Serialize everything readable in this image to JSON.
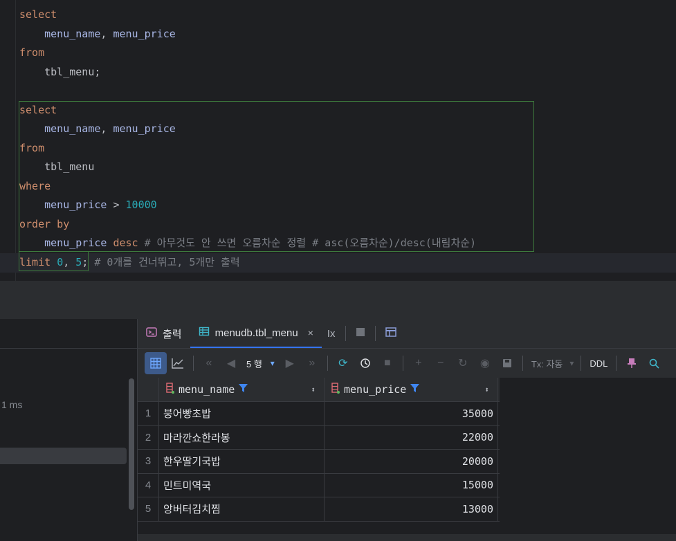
{
  "editor": {
    "lines": [
      [
        {
          "t": "select",
          "c": "kw"
        }
      ],
      [
        {
          "t": "    ",
          "c": "txt"
        },
        {
          "t": "menu_name",
          "c": "col"
        },
        {
          "t": ", ",
          "c": "txt"
        },
        {
          "t": "menu_price",
          "c": "col"
        }
      ],
      [
        {
          "t": "from",
          "c": "kw"
        }
      ],
      [
        {
          "t": "    tbl_menu;",
          "c": "txt"
        }
      ],
      [
        {
          "t": "",
          "c": "txt"
        }
      ],
      [
        {
          "t": "select",
          "c": "kw"
        }
      ],
      [
        {
          "t": "    ",
          "c": "txt"
        },
        {
          "t": "menu_name",
          "c": "col"
        },
        {
          "t": ", ",
          "c": "txt"
        },
        {
          "t": "menu_price",
          "c": "col"
        }
      ],
      [
        {
          "t": "from",
          "c": "kw"
        }
      ],
      [
        {
          "t": "    tbl_menu",
          "c": "txt"
        }
      ],
      [
        {
          "t": "where",
          "c": "kw"
        }
      ],
      [
        {
          "t": "    ",
          "c": "txt"
        },
        {
          "t": "menu_price",
          "c": "col"
        },
        {
          "t": " > ",
          "c": "txt"
        },
        {
          "t": "10000",
          "c": "num"
        }
      ],
      [
        {
          "t": "order by",
          "c": "kw"
        }
      ],
      [
        {
          "t": "    ",
          "c": "txt"
        },
        {
          "t": "menu_price",
          "c": "col"
        },
        {
          "t": " ",
          "c": "txt"
        },
        {
          "t": "desc",
          "c": "kw"
        },
        {
          "t": " # 아무것도 안 쓰면 오름차순 정렬 # asc(오름차순)/desc(내림차순)",
          "c": "cmt"
        }
      ],
      [
        {
          "t": "limit ",
          "c": "kw"
        },
        {
          "t": "0",
          "c": "num"
        },
        {
          "t": ", ",
          "c": "txt"
        },
        {
          "t": "5",
          "c": "num"
        },
        {
          "t": ";",
          "c": "txt"
        },
        {
          "t": " # 0개를 건너뛰고, 5개만 출력",
          "c": "cmt"
        }
      ]
    ]
  },
  "left_panel": {
    "time_text": "1 ms"
  },
  "tabs": {
    "output_label": "출력",
    "table_label": "menudb.tbl_menu",
    "close_glyph": "×",
    "ix_label": "Ix"
  },
  "toolbar": {
    "rows_label": "5 행",
    "tx_label": "Tx: 자동",
    "ddl_label": "DDL"
  },
  "grid": {
    "columns": [
      "menu_name",
      "menu_price"
    ],
    "rows": [
      {
        "n": "1",
        "name": "붕어빵초밥",
        "price": "35000"
      },
      {
        "n": "2",
        "name": "마라깐쇼한라봉",
        "price": "22000"
      },
      {
        "n": "3",
        "name": "한우딸기국밥",
        "price": "20000"
      },
      {
        "n": "4",
        "name": "민트미역국",
        "price": "15000"
      },
      {
        "n": "5",
        "name": "앙버터김치찜",
        "price": "13000"
      }
    ]
  },
  "colors": {
    "accent": "#3574f0",
    "keyword": "#cf8e6d",
    "column": "#a9b7e6",
    "number": "#2aacb8",
    "comment": "#7a7e85"
  }
}
